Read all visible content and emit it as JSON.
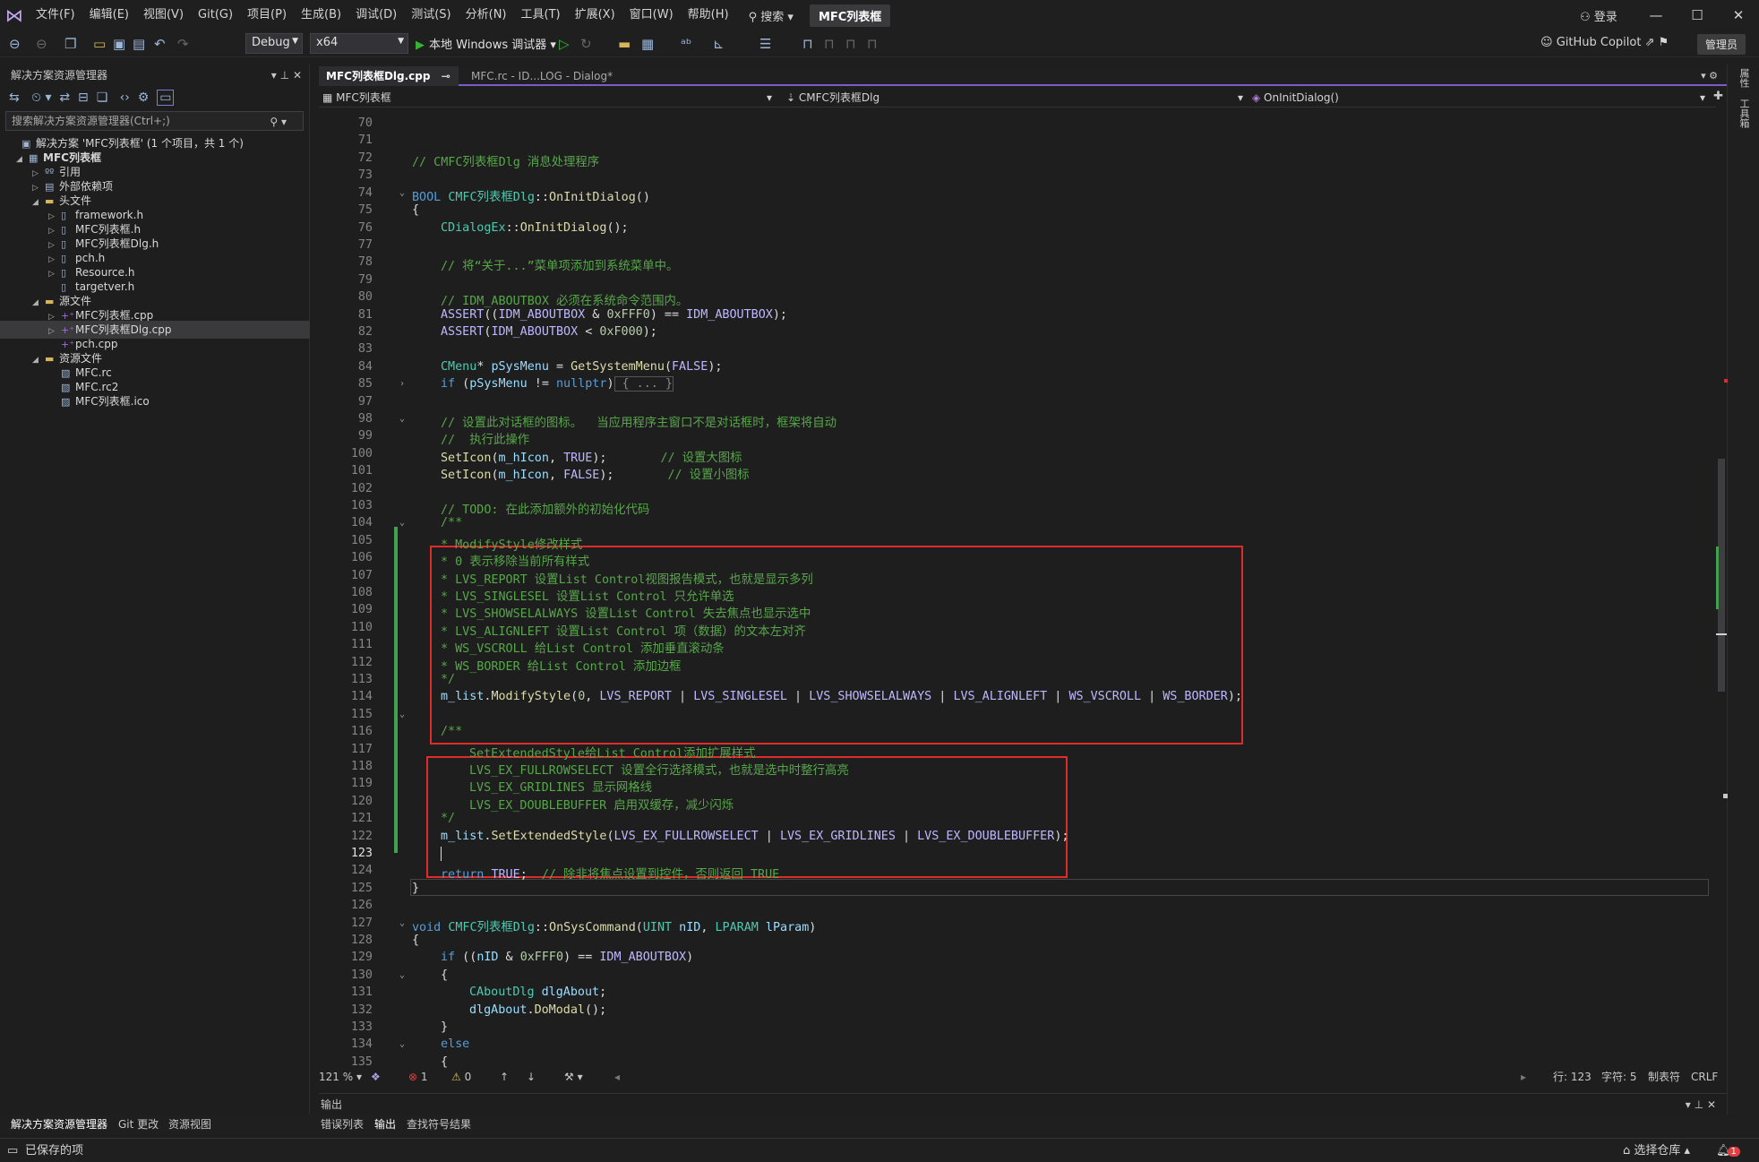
{
  "menubar": {
    "items": [
      "文件(F)",
      "编辑(E)",
      "视图(V)",
      "Git(G)",
      "项目(P)",
      "生成(B)",
      "调试(D)",
      "测试(S)",
      "分析(N)",
      "工具(T)",
      "扩展(X)",
      "窗口(W)",
      "帮助(H)"
    ],
    "search_label": "搜索",
    "title": "MFC列表框",
    "login": "登录"
  },
  "toolbar": {
    "config": "Debug",
    "platform": "x64",
    "run_label": "本地 Windows 调试器",
    "copilot": "GitHub Copilot",
    "admin": "管理员"
  },
  "solution_explorer": {
    "title": "解决方案资源管理器",
    "search_placeholder": "搜索解决方案资源管理器(Ctrl+;)",
    "items": [
      {
        "label": "解决方案 'MFC列表框' (1 个项目，共 1 个)"
      },
      {
        "label": "MFC列表框"
      },
      {
        "label": "引用"
      },
      {
        "label": "外部依赖项"
      },
      {
        "label": "头文件"
      },
      {
        "label": "framework.h"
      },
      {
        "label": "MFC列表框.h"
      },
      {
        "label": "MFC列表框Dlg.h"
      },
      {
        "label": "pch.h"
      },
      {
        "label": "Resource.h"
      },
      {
        "label": "targetver.h"
      },
      {
        "label": "源文件"
      },
      {
        "label": "MFC列表框.cpp"
      },
      {
        "label": "MFC列表框Dlg.cpp"
      },
      {
        "label": "pch.cpp"
      },
      {
        "label": "资源文件"
      },
      {
        "label": "MFC.rc"
      },
      {
        "label": "MFC.rc2"
      },
      {
        "label": "MFC列表框.ico"
      }
    ]
  },
  "editor": {
    "tabs": [
      "MFC列表框Dlg.cpp",
      "MFC.rc - ID...LOG - Dialog*"
    ],
    "nav_project": "MFC列表框",
    "nav_class": "CMFC列表框Dlg",
    "nav_member": "OnInitDialog()",
    "line_numbers": [
      "70",
      "71",
      "72",
      "73",
      "74",
      "75",
      "76",
      "77",
      "78",
      "79",
      "80",
      "81",
      "82",
      "83",
      "84",
      "85",
      "97",
      "98",
      "99",
      "100",
      "101",
      "102",
      "103",
      "104",
      "105",
      "106",
      "107",
      "108",
      "109",
      "110",
      "111",
      "112",
      "113",
      "114",
      "115",
      "116",
      "117",
      "118",
      "119",
      "120",
      "121",
      "122",
      "123",
      "124",
      "125",
      "126",
      "127",
      "128",
      "129",
      "130",
      "131",
      "132",
      "133",
      "134",
      "135"
    ],
    "code": {
      "l72": "// CMFC列表框Dlg 消息处理程序",
      "l74a": "BOOL ",
      "l74b": "CMFC列表框Dlg",
      "l74c": "::",
      "l74d": "OnInitDialog",
      "l74e": "()",
      "l75": "{",
      "l76a": "CDialogEx",
      "l76b": "::",
      "l76c": "OnInitDialog",
      "l76d": "();",
      "l78": "// 将“关于...”菜单项添加到系统菜单中。",
      "l80": "// IDM_ABOUTBOX 必须在系统命令范围内。",
      "l81a": "ASSERT",
      "l81b": "((",
      "l81c": "IDM_ABOUTBOX",
      "l81d": " & ",
      "l81e": "0xFFF0",
      "l81f": ") == ",
      "l81g": "IDM_ABOUTBOX",
      "l81h": ");",
      "l82a": "ASSERT",
      "l82b": "(",
      "l82c": "IDM_ABOUTBOX",
      "l82d": " < ",
      "l82e": "0xF000",
      "l82f": ");",
      "l84a": "CMenu",
      "l84b": "* ",
      "l84c": "pSysMenu",
      "l84d": " = ",
      "l84e": "GetSystemMenu",
      "l84f": "(",
      "l84g": "FALSE",
      "l84h": ");",
      "l85a": "if",
      "l85b": " (",
      "l85c": "pSysMenu",
      "l85d": " != ",
      "l85e": "nullptr",
      "l85f": ")",
      "l85g": " { ... }",
      "l98": "// 设置此对话框的图标。  当应用程序主窗口不是对话框时，框架将自动",
      "l99": "//  执行此操作",
      "l100a": "SetIcon",
      "l100b": "(",
      "l100c": "m_hIcon",
      "l100d": ", ",
      "l100e": "TRUE",
      "l100f": ");",
      "l100g": "// 设置大图标",
      "l101a": "SetIcon",
      "l101b": "(",
      "l101c": "m_hIcon",
      "l101d": ", ",
      "l101e": "FALSE",
      "l101f": ");",
      "l101g": "// 设置小图标",
      "l103": "// TODO: 在此添加额外的初始化代码",
      "l104": "/**",
      "l105": "* ModifyStyle修改样式",
      "l106": "* 0 表示移除当前所有样式",
      "l107": "* LVS_REPORT 设置List Control视图报告模式，也就是显示多列",
      "l108": "* LVS_SINGLESEL 设置List Control 只允许单选",
      "l109": "* LVS_SHOWSELALWAYS 设置List Control 失去焦点也显示选中",
      "l110": "* LVS_ALIGNLEFT 设置List Control 项（数据）的文本左对齐",
      "l111": "* WS_VSCROLL 给List Control 添加垂直滚动条",
      "l112": "* WS_BORDER 给List Control 添加边框",
      "l113": "*/",
      "l114a": "m_list",
      "l114b": ".",
      "l114c": "ModifyStyle",
      "l114d": "(",
      "l114e": "0",
      "l114f": ", ",
      "l114g": "LVS_REPORT",
      "l114h": " | ",
      "l114i": "LVS_SINGLESEL",
      "l114j": " | ",
      "l114k": "LVS_SHOWSELALWAYS",
      "l114l": " | ",
      "l114m": "LVS_ALIGNLEFT",
      "l114n": " | ",
      "l114o": "WS_VSCROLL",
      "l114p": " | ",
      "l114q": "WS_BORDER",
      "l114r": ");",
      "l116": "/**",
      "l117": "SetExtendedStyle给List Control添加扩展样式",
      "l118": "LVS_EX_FULLROWSELECT 设置全行选择模式，也就是选中时整行高亮",
      "l119": "LVS_EX_GRIDLINES 显示网格线",
      "l120": "LVS_EX_DOUBLEBUFFER 启用双缓存，减少闪烁",
      "l121": "*/",
      "l122a": "m_list",
      "l122b": ".",
      "l122c": "SetExtendedStyle",
      "l122d": "(",
      "l122e": "LVS_EX_FULLROWSELECT",
      "l122f": " | ",
      "l122g": "LVS_EX_GRIDLINES",
      "l122h": " | ",
      "l122i": "LVS_EX_DOUBLEBUFFER",
      "l122j": ");",
      "l124a": "return",
      "l124b": " ",
      "l124c": "TRUE",
      "l124d": ";  ",
      "l124e": "// 除非将焦点设置到控件，否则返回 TRUE",
      "l125": "}",
      "l127a": "void ",
      "l127b": "CMFC列表框Dlg",
      "l127c": "::",
      "l127d": "OnSysCommand",
      "l127e": "(",
      "l127f": "UINT",
      "l127g": " ",
      "l127h": "nID",
      "l127i": ", ",
      "l127j": "LPARAM",
      "l127k": " ",
      "l127l": "lParam",
      "l127m": ")",
      "l128": "{",
      "l129a": "if",
      "l129b": " ((",
      "l129c": "nID",
      "l129d": " & ",
      "l129e": "0xFFF0",
      "l129f": ") == ",
      "l129g": "IDM_ABOUTBOX",
      "l129h": ")",
      "l130": "{",
      "l131a": "CAboutDlg",
      "l131b": " ",
      "l131c": "dlgAbout",
      "l131d": ";",
      "l132a": "dlgAbout",
      "l132b": ".",
      "l132c": "DoModal",
      "l132d": "();",
      "l133": "}",
      "l134": "else",
      "l135": "{"
    }
  },
  "editor_status": {
    "zoom": "121 %",
    "errors": "1",
    "warnings": "0",
    "line": "行: 123",
    "col": "字符: 5",
    "tabs": "制表符",
    "eol": "CRLF"
  },
  "output": {
    "title": "输出"
  },
  "bottom_tabs": {
    "left": [
      "解决方案资源管理器",
      "Git 更改",
      "资源视图"
    ],
    "right": [
      "错误列表",
      "输出",
      "查找符号结果"
    ]
  },
  "statusbar": {
    "saved": "已保存的项",
    "repo": "选择仓库",
    "notifications": "1"
  },
  "right_strip": {
    "items": [
      "属性",
      "工具箱"
    ]
  }
}
